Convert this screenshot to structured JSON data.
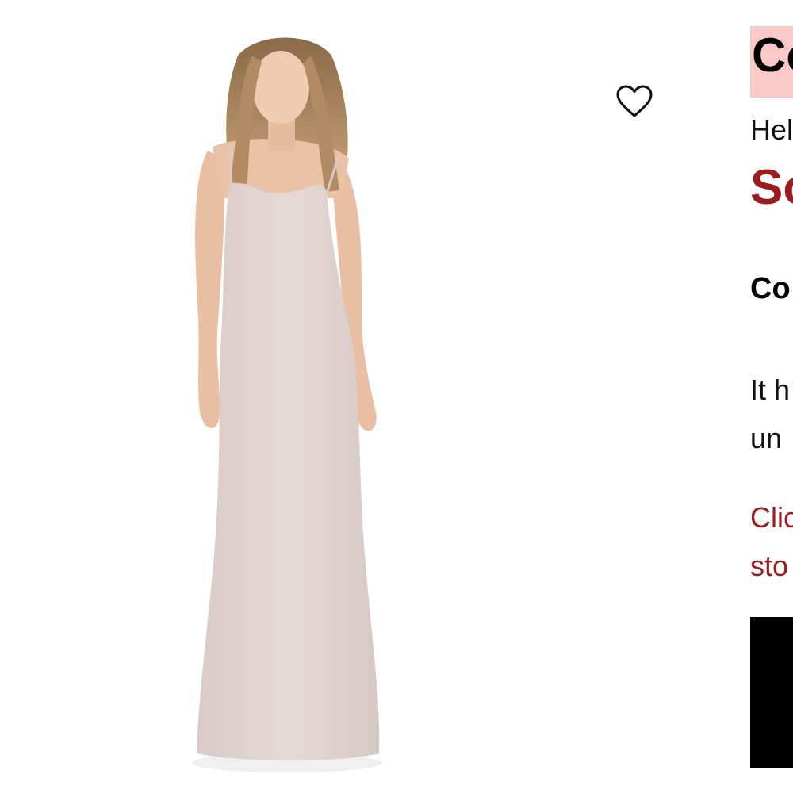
{
  "product": {
    "image_alt": "Model wearing a long blush maxi slip dress",
    "title": "Co",
    "brand": "Hel",
    "status": "So",
    "color_label": "Co",
    "description_lines": [
      "It h",
      "un"
    ],
    "link_lines": [
      "Clic",
      "sto"
    ],
    "cta_label": ""
  },
  "icons": {
    "wishlist": "heart-outline-icon"
  },
  "colors": {
    "accent": "#9b1c1f",
    "title_highlight": "#f8c9c6",
    "dress": "#ddd0cc",
    "button": "#000000"
  }
}
